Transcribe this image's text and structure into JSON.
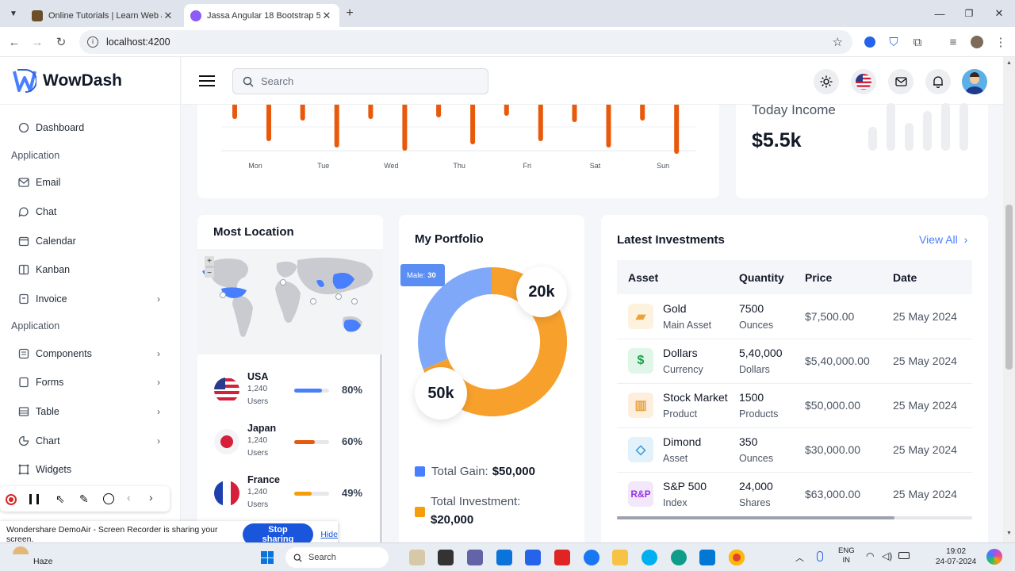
{
  "browser": {
    "tabs": [
      {
        "title": "Online Tutorials | Learn Web &",
        "active": false
      },
      {
        "title": "Jassa Angular 18 Bootstrap 5 A",
        "active": true
      }
    ],
    "url": "localhost:4200"
  },
  "sidebar": {
    "logo_text": "WowDash",
    "items": [
      {
        "label": "Dashboard",
        "icon": "home-icon"
      },
      {
        "header": "Application"
      },
      {
        "label": "Email",
        "icon": "mail-icon"
      },
      {
        "label": "Chat",
        "icon": "chat-icon"
      },
      {
        "label": "Calendar",
        "icon": "calendar-icon"
      },
      {
        "label": "Kanban",
        "icon": "kanban-icon"
      },
      {
        "label": "Invoice",
        "icon": "invoice-icon",
        "chevron": true
      },
      {
        "header": "Application"
      },
      {
        "label": "Components",
        "icon": "components-icon",
        "chevron": true
      },
      {
        "label": "Forms",
        "icon": "forms-icon",
        "chevron": true
      },
      {
        "label": "Table",
        "icon": "table-icon",
        "chevron": true
      },
      {
        "label": "Chart",
        "icon": "chart-icon",
        "chevron": true
      },
      {
        "label": "Widgets",
        "icon": "widgets-icon"
      }
    ]
  },
  "topbar": {
    "search_placeholder": "Search"
  },
  "weekly_chart": {
    "days": [
      "Mon",
      "Tue",
      "Wed",
      "Thu",
      "Fri",
      "Sat",
      "Sun"
    ],
    "bar_color": "#e8590c"
  },
  "today_income": {
    "label": "Today Income",
    "value": "$5.5k"
  },
  "most_location": {
    "title": "Most Location",
    "map_zoom_in": "+",
    "map_zoom_out": "−",
    "countries": [
      {
        "name": "USA",
        "count": "1,240",
        "unit": "Users",
        "percent": "80%",
        "fill": 0.8,
        "color": "#487fff"
      },
      {
        "name": "Japan",
        "count": "1,240",
        "unit": "Users",
        "percent": "60%",
        "fill": 0.6,
        "color": "#e8590c"
      },
      {
        "name": "France",
        "count": "1,240",
        "unit": "Users",
        "percent": "49%",
        "fill": 0.49,
        "color": "#f59e0b"
      }
    ]
  },
  "portfolio": {
    "title": "My Portfolio",
    "tooltip_label": "Male:",
    "tooltip_value": "30",
    "bubble_top": "20k",
    "bubble_bottom": "50k",
    "gain_label": "Total Gain:",
    "gain_value": "$50,000",
    "investment_label": "Total Investment:",
    "investment_value": "$20,000",
    "colors": {
      "gain": "#487fff",
      "investment": "#f59e0b",
      "blue_slice": "#7fa9f8",
      "orange_slice": "#f7a02c"
    }
  },
  "investments": {
    "title": "Latest Investments",
    "view_all": "View All",
    "columns": [
      "Asset",
      "Quantity",
      "Price",
      "Date"
    ],
    "rows": [
      {
        "asset": "Gold",
        "sub": "Main Asset",
        "qty": "7500",
        "qty_unit": "Ounces",
        "price": "$7,500.00",
        "date": "25 May 2024",
        "icon": "gold-icon",
        "bg": "#fdf2dd"
      },
      {
        "asset": "Dollars",
        "sub": "Currency",
        "qty": "5,40,000",
        "qty_unit": "Dollars",
        "price": "$5,40,000.00",
        "date": "25 May 2024",
        "icon": "dollar-icon",
        "bg": "#e0f6e9"
      },
      {
        "asset": "Stock Market",
        "sub": "Product",
        "qty": "1500",
        "qty_unit": "Products",
        "price": "$50,000.00",
        "date": "25 May 2024",
        "icon": "stock-icon",
        "bg": "#fdeedd"
      },
      {
        "asset": "Dimond",
        "sub": "Asset",
        "qty": "350",
        "qty_unit": "Ounces",
        "price": "$30,000.00",
        "date": "25 May 2024",
        "icon": "diamond-icon",
        "bg": "#e3f1fb"
      },
      {
        "asset": "S&P 500",
        "sub": "Index",
        "qty": "24,000",
        "qty_unit": "Shares",
        "price": "$63,000.00",
        "date": "25 May 2024",
        "icon": "sp500-icon",
        "bg": "#f3e8fb"
      }
    ]
  },
  "screen_share": {
    "message": "Wondershare DemoAir - Screen Recorder is sharing your screen.",
    "stop_label": "Stop sharing",
    "hide_label": "Hide"
  },
  "taskbar": {
    "weather_label": "Haze",
    "search_label": "Search",
    "lang_top": "ENG",
    "lang_bottom": "IN",
    "time": "19:02",
    "date": "24-07-2024"
  }
}
